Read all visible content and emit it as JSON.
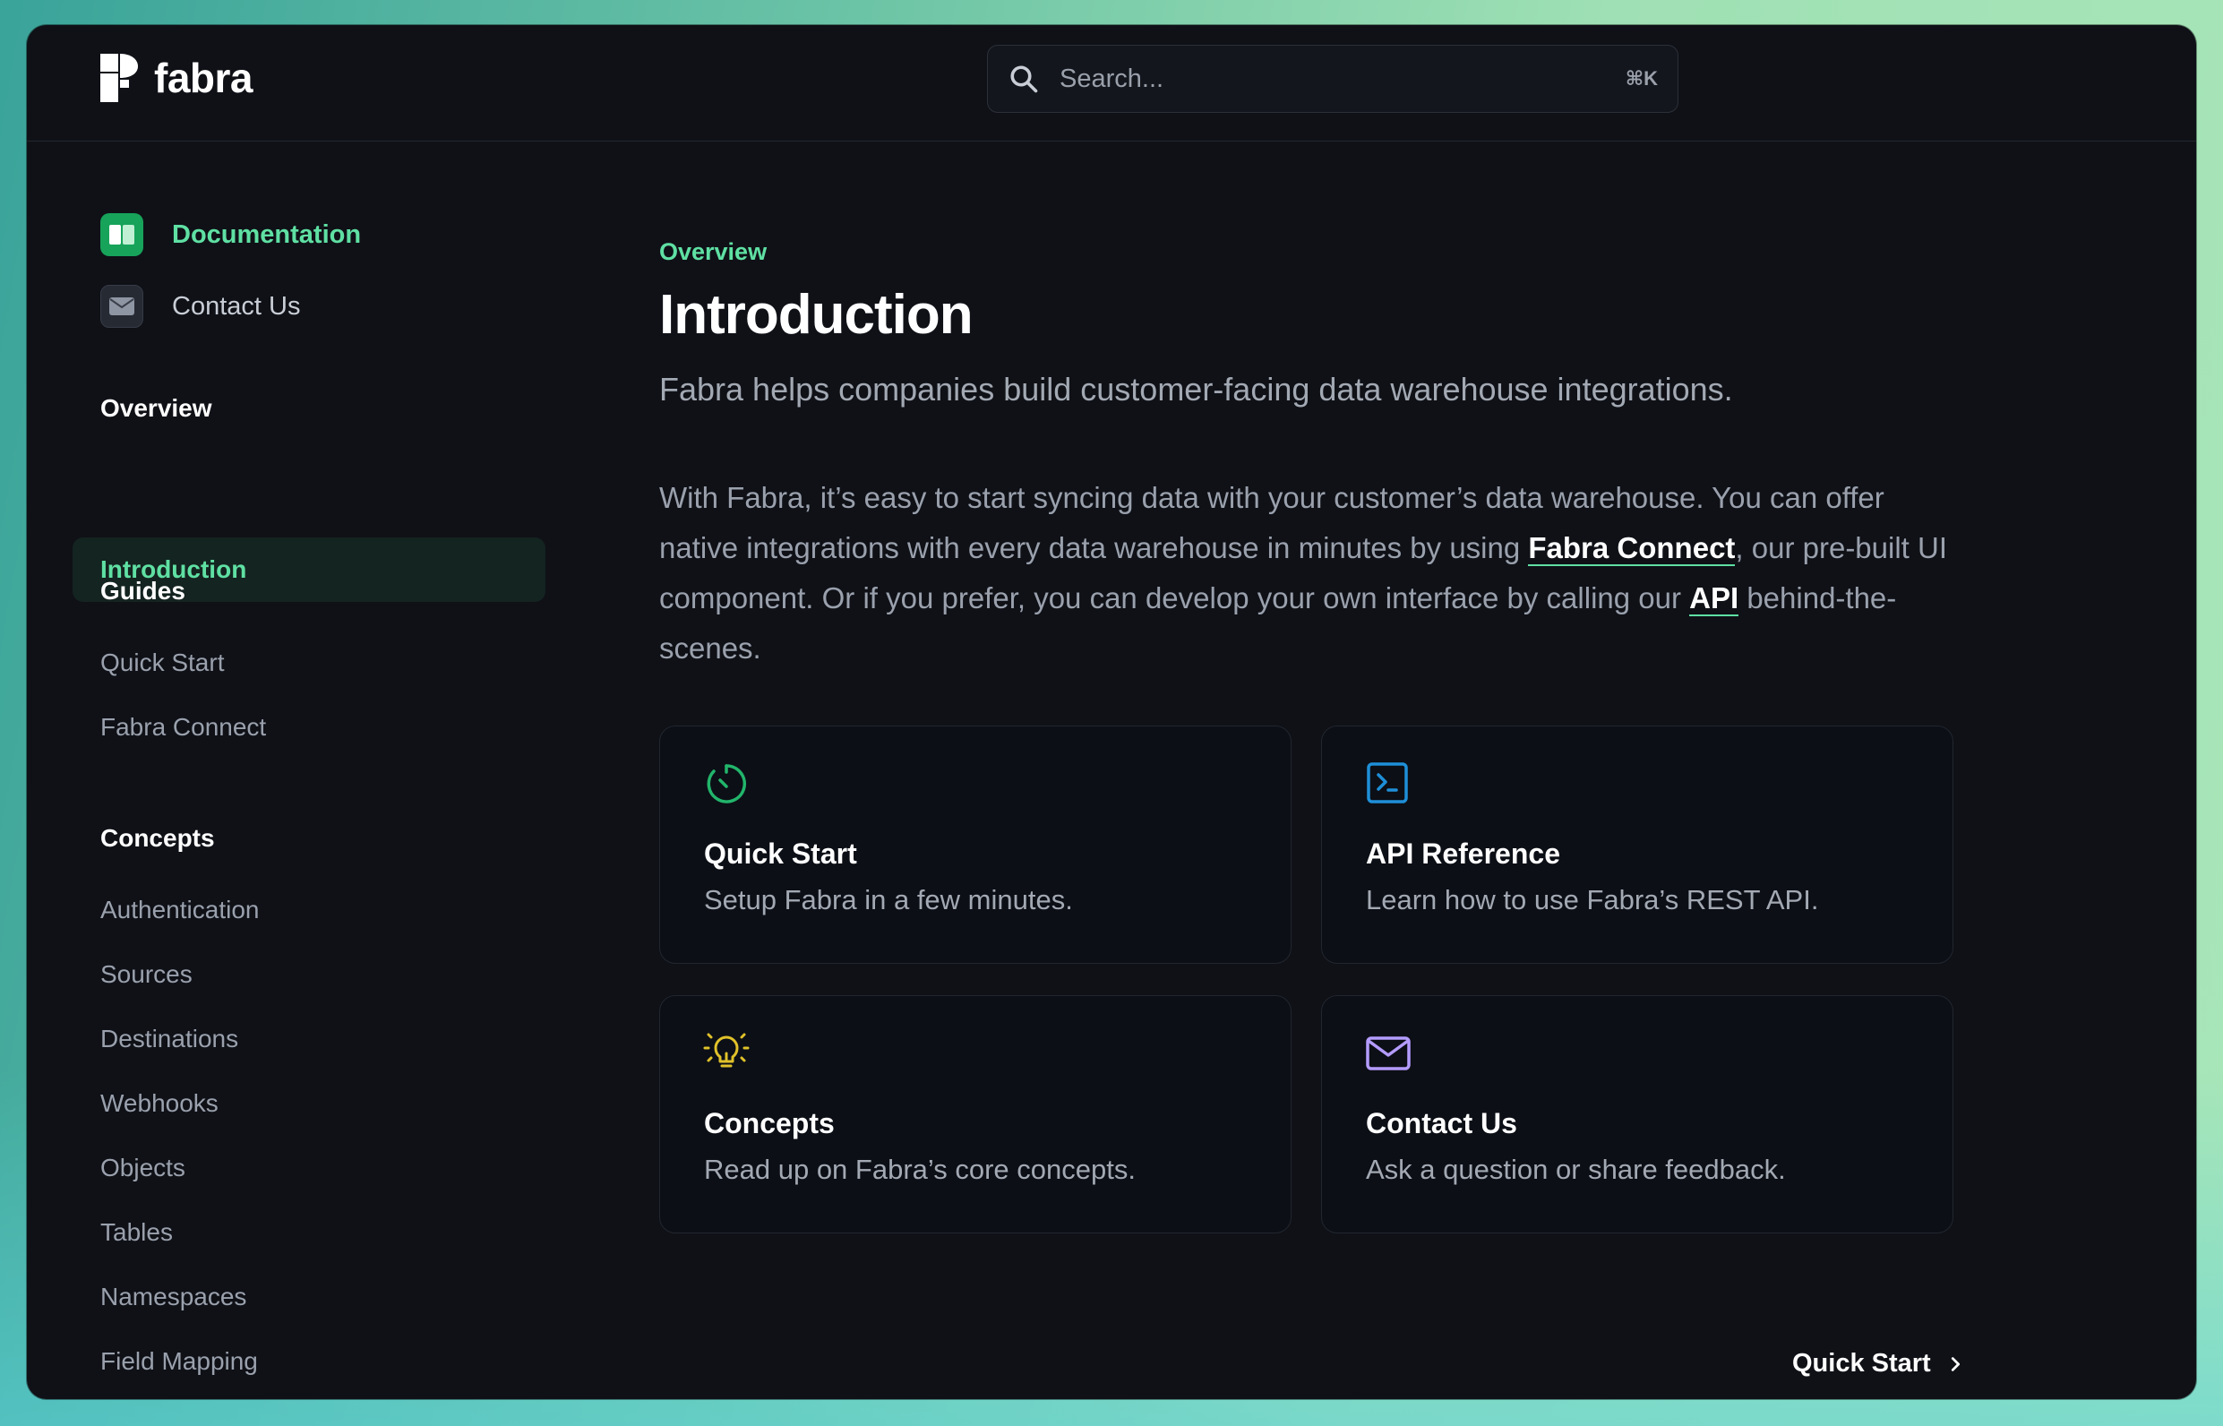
{
  "brand": {
    "name": "fabra"
  },
  "search": {
    "placeholder": "Search...",
    "shortcut": "⌘K"
  },
  "sidebar": {
    "top_links": [
      {
        "label": "Documentation",
        "icon": "book-icon",
        "active": true
      },
      {
        "label": "Contact Us",
        "icon": "envelope-icon",
        "active": false
      }
    ],
    "sections": [
      {
        "title": "Overview",
        "items": [
          "Introduction"
        ]
      },
      {
        "title": "Guides",
        "items": [
          "Quick Start",
          "Fabra Connect"
        ]
      },
      {
        "title": "Concepts",
        "items": [
          "Authentication",
          "Sources",
          "Destinations",
          "Webhooks",
          "Objects",
          "Tables",
          "Namespaces",
          "Field Mapping"
        ]
      }
    ],
    "active_item": "Introduction"
  },
  "main": {
    "eyebrow": "Overview",
    "title": "Introduction",
    "lead": "Fabra helps companies build customer-facing data warehouse integrations.",
    "paragraph": {
      "part1": "With Fabra, it’s easy to start syncing data with your customer’s data warehouse. You can offer native integrations with every data warehouse in minutes by using ",
      "link1": "Fabra Connect",
      "part2": ", our pre-built UI component. Or if you prefer, you can develop your own interface by calling our ",
      "link2": "API",
      "part3": " behind-the-scenes."
    },
    "cards": [
      {
        "title": "Quick Start",
        "desc": "Setup Fabra in a few minutes.",
        "icon": "stopwatch-icon",
        "color": "#22b56b"
      },
      {
        "title": "API Reference",
        "desc": "Learn how to use Fabra’s REST API.",
        "icon": "terminal-icon",
        "color": "#1e8fd8"
      },
      {
        "title": "Concepts",
        "desc": "Read up on Fabra’s core concepts.",
        "icon": "lightbulb-icon",
        "color": "#e0c12a"
      },
      {
        "title": "Contact Us",
        "desc": "Ask a question or share feedback.",
        "icon": "envelope-icon",
        "color": "#b49cff"
      }
    ],
    "next": {
      "label": "Quick Start"
    }
  },
  "colors": {
    "accent": "#5fe0a3",
    "background": "#0f1117"
  }
}
